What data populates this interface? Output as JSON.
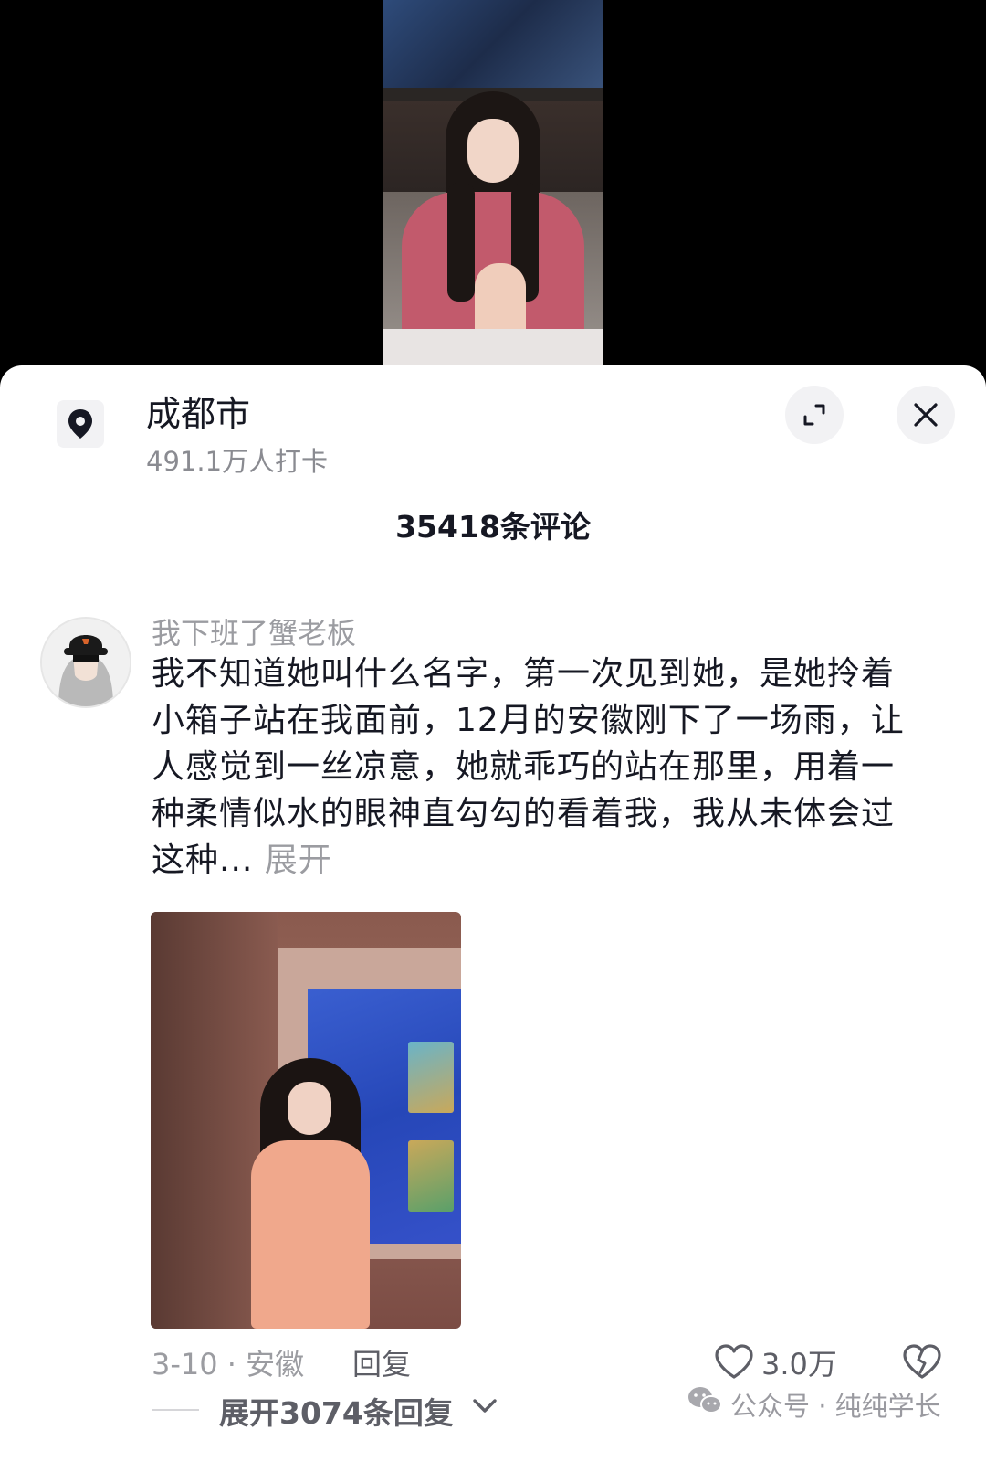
{
  "location": {
    "name": "成都市",
    "checkins": "491.1万人打卡"
  },
  "comments_header": "35418条评论",
  "comment": {
    "username": "我下班了蟹老板",
    "text": "我不知道她叫什么名字，第一次见到她，是她拎着小箱子站在我面前，12月的安徽刚下了一场雨，让人感觉到一丝凉意，她就乖巧的站在那里，用着一种柔情似水的眼神直勾勾的看着我，我从未体会过这种...",
    "expand_label": "展开",
    "date_location": "3-10 · 安徽",
    "reply_label": "回复",
    "like_count": "3.0万",
    "expand_replies": "展开3074条回复"
  },
  "watermark": "公众号 · 纯纯学长",
  "icons": {
    "location": "location-pin-icon",
    "expand": "expand-icon",
    "close": "close-icon",
    "like": "heart-icon",
    "dislike": "broken-heart-icon",
    "chevron": "chevron-down-icon",
    "wechat": "wechat-icon"
  }
}
